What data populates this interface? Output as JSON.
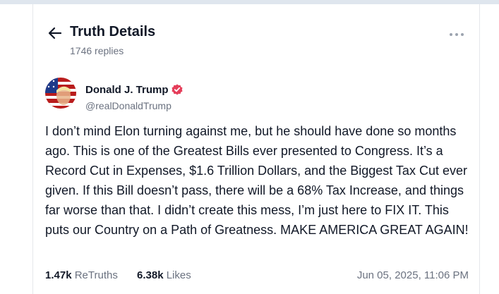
{
  "header": {
    "title": "Truth Details",
    "replies": "1746 replies",
    "back_icon": "arrow-left-icon",
    "more_icon": "more-horizontal-icon"
  },
  "post": {
    "author_name": "Donald J. Trump",
    "handle": "@realDonaldTrump",
    "verified_color": "#e53e5a",
    "text": "I don’t mind Elon turning against me, but he should have done so months ago. This is one of the Greatest Bills ever presented to Congress. It’s a Record Cut in Expenses, $1.6 Trillion Dollars, and the Biggest Tax Cut ever given. If this Bill doesn’t pass, there will be a 68% Tax Increase, and things far worse than that. I didn’t create this mess, I’m just here to FIX IT. This puts our Country on a Path of Greatness. MAKE AMERICA GREAT AGAIN!",
    "retruths_count": "1.47k",
    "retruths_label": "ReTruths",
    "likes_count": "6.38k",
    "likes_label": "Likes",
    "timestamp": "Jun 05, 2025, 11:06 PM"
  },
  "colors": {
    "top_bar": "#dfe6ee",
    "text_primary": "#111827",
    "text_muted": "#6b7280"
  }
}
